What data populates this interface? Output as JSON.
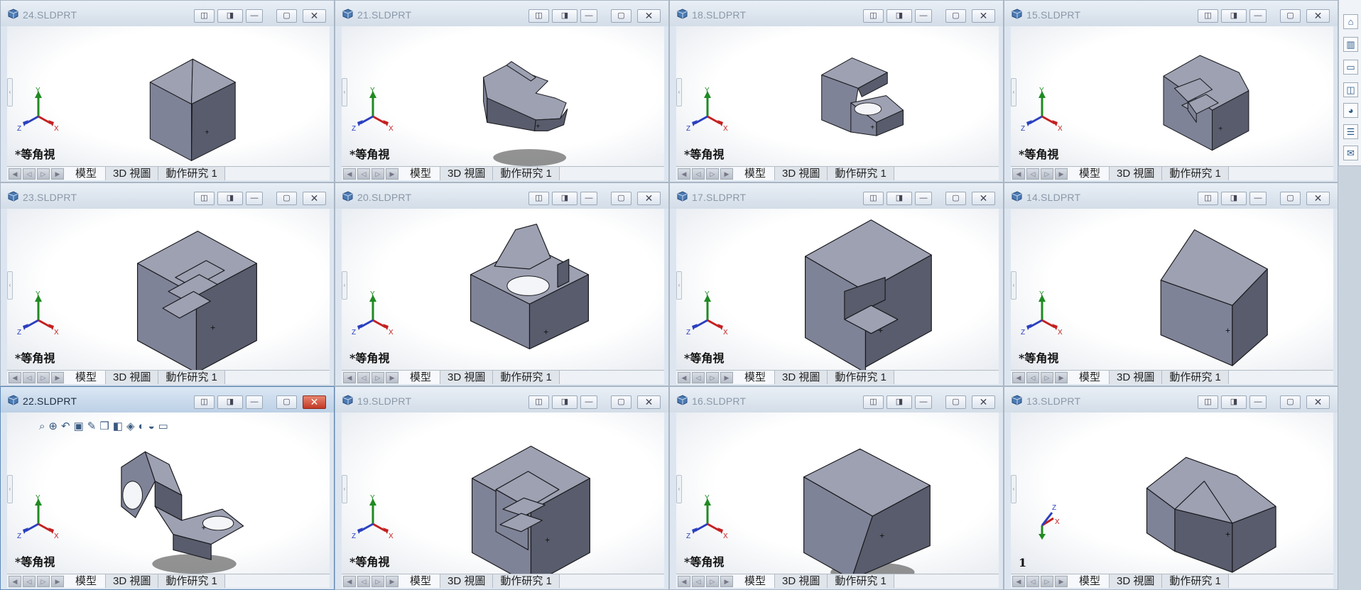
{
  "windows": [
    {
      "title": "24.SLDPRT",
      "active": false
    },
    {
      "title": "21.SLDPRT",
      "active": false
    },
    {
      "title": "18.SLDPRT",
      "active": false
    },
    {
      "title": "15.SLDPRT",
      "active": false
    },
    {
      "title": "23.SLDPRT",
      "active": false
    },
    {
      "title": "20.SLDPRT",
      "active": false
    },
    {
      "title": "17.SLDPRT",
      "active": false
    },
    {
      "title": "14.SLDPRT",
      "active": false
    },
    {
      "title": "22.SLDPRT",
      "active": true
    },
    {
      "title": "19.SLDPRT",
      "active": false
    },
    {
      "title": "16.SLDPRT",
      "active": false
    },
    {
      "title": "13.SLDPRT",
      "active": false
    }
  ],
  "view_label": "*等角視",
  "view_label_13": "1",
  "tabs": {
    "model": "模型",
    "view3d": "3D 視圖",
    "motion": "動作研究 1"
  },
  "triad": {
    "x": "X",
    "y": "Y",
    "z": "Z"
  },
  "colors": {
    "part_light": "#9da1b2",
    "part_mid": "#7f8397",
    "part_dark": "#585c6c",
    "edge": "#1a1a1e"
  },
  "icons": {
    "taskpane": [
      "home-icon",
      "design-library-icon",
      "file-explorer-icon",
      "view-palette-icon",
      "appearances-icon",
      "custom-properties-icon",
      "forum-icon"
    ],
    "hud": [
      "zoom-to-fit-icon",
      "zoom-area-icon",
      "previous-view-icon",
      "section-view-icon",
      "dynamic-annotation-icon",
      "view-orientation-icon",
      "display-style-icon",
      "hide-show-icon",
      "edit-appearance-icon",
      "apply-scene-icon",
      "view-settings-icon"
    ]
  }
}
